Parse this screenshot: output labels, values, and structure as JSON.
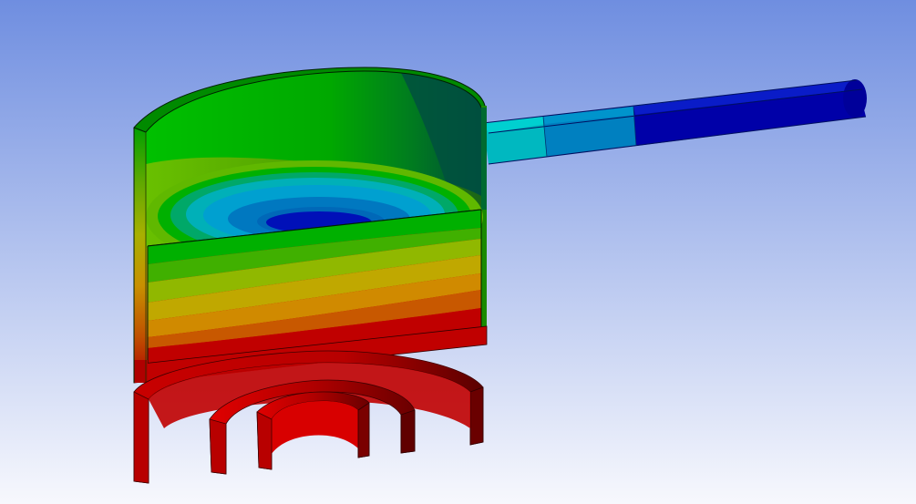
{
  "viewport": {
    "background_top": "#6f8ee0",
    "background_bottom": "#f7f8fd"
  },
  "model": {
    "parts": [
      "pan-body",
      "pan-handle",
      "burner-rings"
    ],
    "contour_palette": {
      "level_1_min": "#0010b8",
      "level_2": "#0060c8",
      "level_3": "#0090d0",
      "level_4": "#00c0c0",
      "level_5": "#00b070",
      "level_6": "#00c000",
      "level_7": "#60c000",
      "level_8": "#a8b800",
      "level_9": "#d0a000",
      "level_10": "#d07000",
      "level_11_max": "#c00000"
    }
  }
}
